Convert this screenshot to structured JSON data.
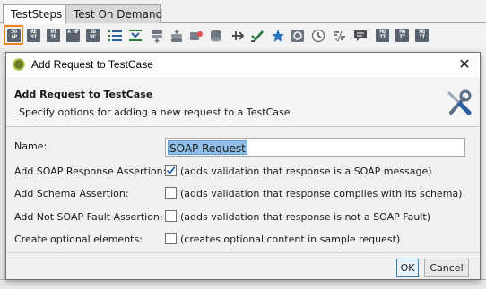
{
  "tabs": [
    {
      "label": "TestSteps",
      "active": true
    },
    {
      "label": "Test On Demand",
      "active": false
    }
  ],
  "toolbar": {
    "icons": [
      {
        "name": "add-soap-request-icon",
        "text": "SO AP",
        "selected": true
      },
      {
        "name": "add-rest-request-icon",
        "text": "RE ST"
      },
      {
        "name": "add-http-request-icon",
        "text": "HT TP"
      },
      {
        "name": "add-amf-request-icon",
        "text": "A MF"
      },
      {
        "name": "add-jdbc-request-icon",
        "text": "JD BC"
      },
      {
        "name": "list-icon"
      },
      {
        "name": "groovy-script-icon"
      },
      {
        "name": "datasource-icon"
      },
      {
        "name": "datasink-icon"
      },
      {
        "name": "property-transfer-icon"
      },
      {
        "name": "database-icon"
      },
      {
        "name": "goto-icon"
      },
      {
        "name": "check-icon"
      },
      {
        "name": "star-icon"
      },
      {
        "name": "loop-icon"
      },
      {
        "name": "delay-icon"
      },
      {
        "name": "properties-icon"
      },
      {
        "name": "comment-icon"
      },
      {
        "name": "mq-icon",
        "text": "MQ TT"
      },
      {
        "name": "mqtt-icon",
        "text": "MQ TT"
      },
      {
        "name": "mqtt-publish-icon",
        "text": "MQ TT"
      }
    ]
  },
  "dialog": {
    "title": "Add Request to TestCase",
    "close_label": "✕",
    "header": {
      "title": "Add Request to TestCase",
      "description": "Specify options for adding a new request to a TestCase"
    },
    "form": {
      "name_label": "Name:",
      "name_value": "SOAP Request",
      "options": [
        {
          "label": "Add SOAP Response Assertion:",
          "checked": true,
          "description": "(adds validation that response is a SOAP message)"
        },
        {
          "label": "Add Schema Assertion:",
          "checked": false,
          "description": "(adds validation that response complies with its schema)"
        },
        {
          "label": "Add Not SOAP Fault Assertion:",
          "checked": false,
          "description": "(adds validation that response is not a SOAP Fault)"
        },
        {
          "label": "Create optional elements:",
          "checked": false,
          "description": "(creates optional content in sample request)"
        }
      ]
    },
    "buttons": {
      "ok": "OK",
      "cancel": "Cancel"
    }
  },
  "colors": {
    "accent_selected": "#e8841a",
    "selection": "#8fbfe8",
    "checkmark": "#1f5fa8"
  }
}
